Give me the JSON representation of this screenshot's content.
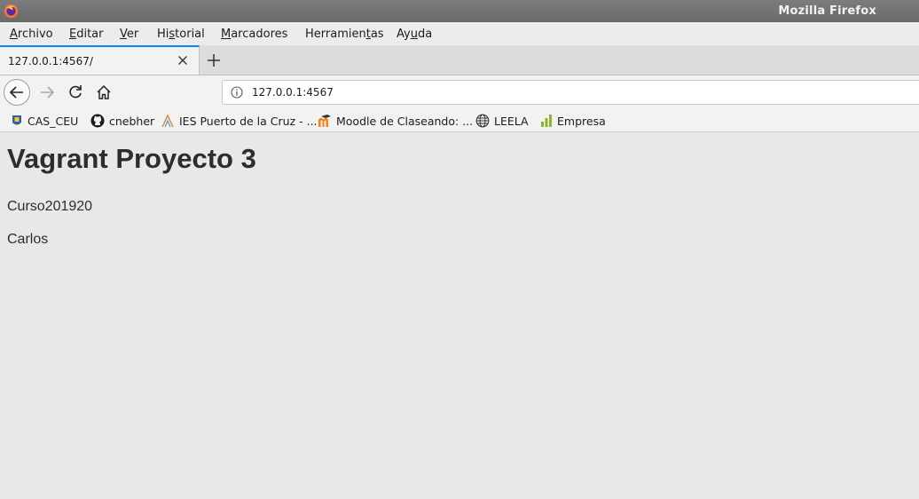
{
  "window": {
    "title": "Mozilla Firefox"
  },
  "menu": {
    "items": [
      {
        "pre": "",
        "key": "A",
        "post": "rchivo"
      },
      {
        "pre": "",
        "key": "E",
        "post": "ditar"
      },
      {
        "pre": "",
        "key": "V",
        "post": "er"
      },
      {
        "pre": "Hi",
        "key": "s",
        "post": "torial"
      },
      {
        "pre": "",
        "key": "M",
        "post": "arcadores"
      },
      {
        "pre": "Herramien",
        "key": "t",
        "post": "as"
      },
      {
        "pre": "Ay",
        "key": "u",
        "post": "da"
      }
    ]
  },
  "tabs": [
    {
      "title": "127.0.0.1:4567/"
    }
  ],
  "urlbar": {
    "url": "127.0.0.1:4567"
  },
  "bookmarks": [
    {
      "label": "CAS_CEU",
      "icon": "shield-icon"
    },
    {
      "label": "cnebher",
      "icon": "github-icon"
    },
    {
      "label": "IES Puerto de la Cruz - ...",
      "icon": "school-icon"
    },
    {
      "label": "Moodle de Claseando: ...",
      "icon": "moodle-icon"
    },
    {
      "label": "LEELA",
      "icon": "globe-icon"
    },
    {
      "label": "Empresa",
      "icon": "chart-icon"
    }
  ],
  "page": {
    "heading": "Vagrant Proyecto 3",
    "line1": "Curso201920",
    "line2": "Carlos"
  }
}
